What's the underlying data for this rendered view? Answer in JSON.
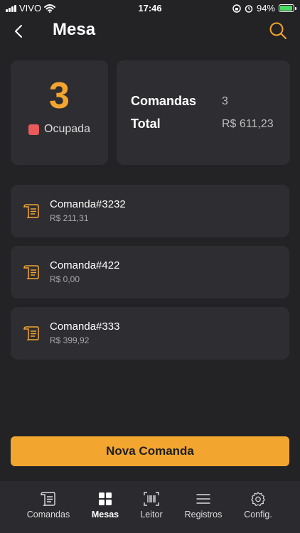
{
  "status_bar": {
    "carrier": "VIVO",
    "time": "17:46",
    "battery": "94%",
    "battery_level": 0.94
  },
  "header": {
    "title": "Mesa"
  },
  "table": {
    "number": "3",
    "status": "Ocupada",
    "status_color": "#e95a5a"
  },
  "summary": {
    "comandas_label": "Comandas",
    "comandas_value": "3",
    "total_label": "Total",
    "total_value": "R$ 611,23"
  },
  "comandas": [
    {
      "name": "Comanda#3232",
      "total": "R$ 211,31"
    },
    {
      "name": "Comanda#422",
      "total": "R$ 0,00"
    },
    {
      "name": "Comanda#333",
      "total": "R$ 399,92"
    }
  ],
  "actions": {
    "new_comanda": "Nova Comanda"
  },
  "tabs": [
    {
      "label": "Comandas",
      "icon": "receipt-icon"
    },
    {
      "label": "Mesas",
      "icon": "grid-icon",
      "active": true
    },
    {
      "label": "Leitor",
      "icon": "barcode-icon"
    },
    {
      "label": "Registros",
      "icon": "list-icon"
    },
    {
      "label": "Config.",
      "icon": "gear-icon"
    }
  ],
  "colors": {
    "accent": "#f2a630",
    "background": "#232225",
    "card": "#2e2d31"
  }
}
